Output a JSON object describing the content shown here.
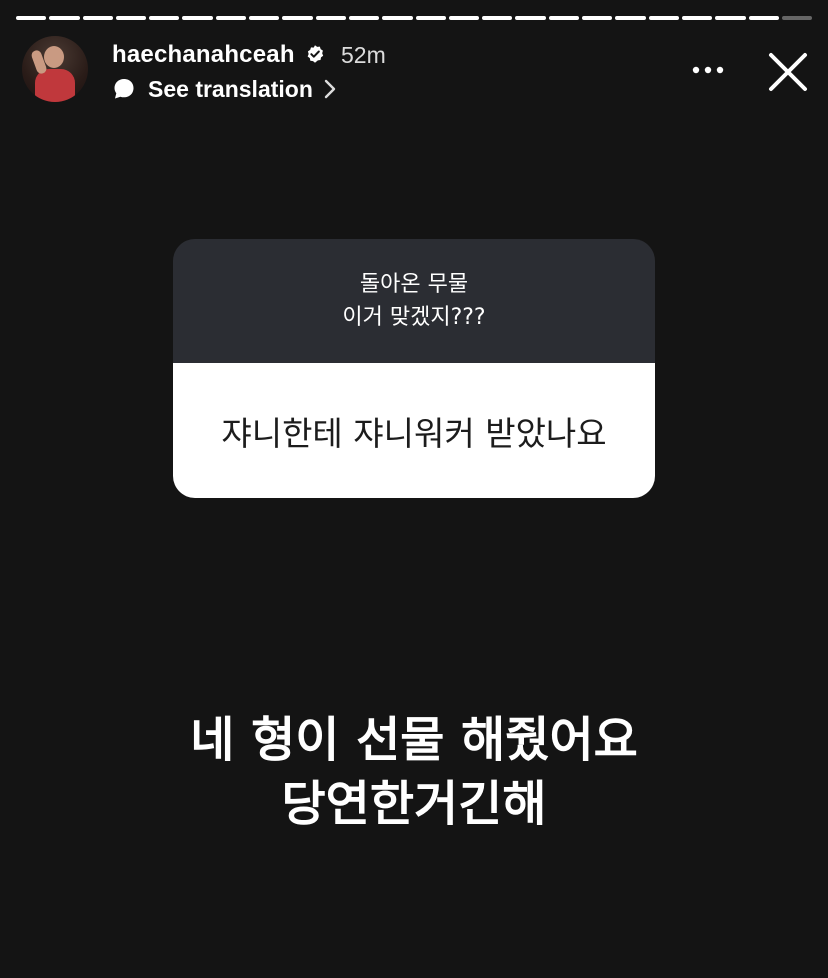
{
  "story": {
    "progress": {
      "segments": 24,
      "viewed": 23
    },
    "colors": {
      "background": "#141414",
      "card_top": "#2b2d33",
      "card_bottom": "#ffffff"
    }
  },
  "header": {
    "username": "haechanahceah",
    "verified_icon": "verified-badge-icon",
    "time": "52m",
    "translate_label": "See translation",
    "more_icon": "more-horizontal-icon",
    "close_icon": "close-icon"
  },
  "question_card": {
    "prompt_line1": "돌아온 무물",
    "prompt_line2": "이거 맞겠지???",
    "question": "쟈니한테 쟈니워커 받았나요"
  },
  "answer": {
    "line1": "네 형이 선물 해줬어요",
    "line2": "당연한거긴해"
  }
}
